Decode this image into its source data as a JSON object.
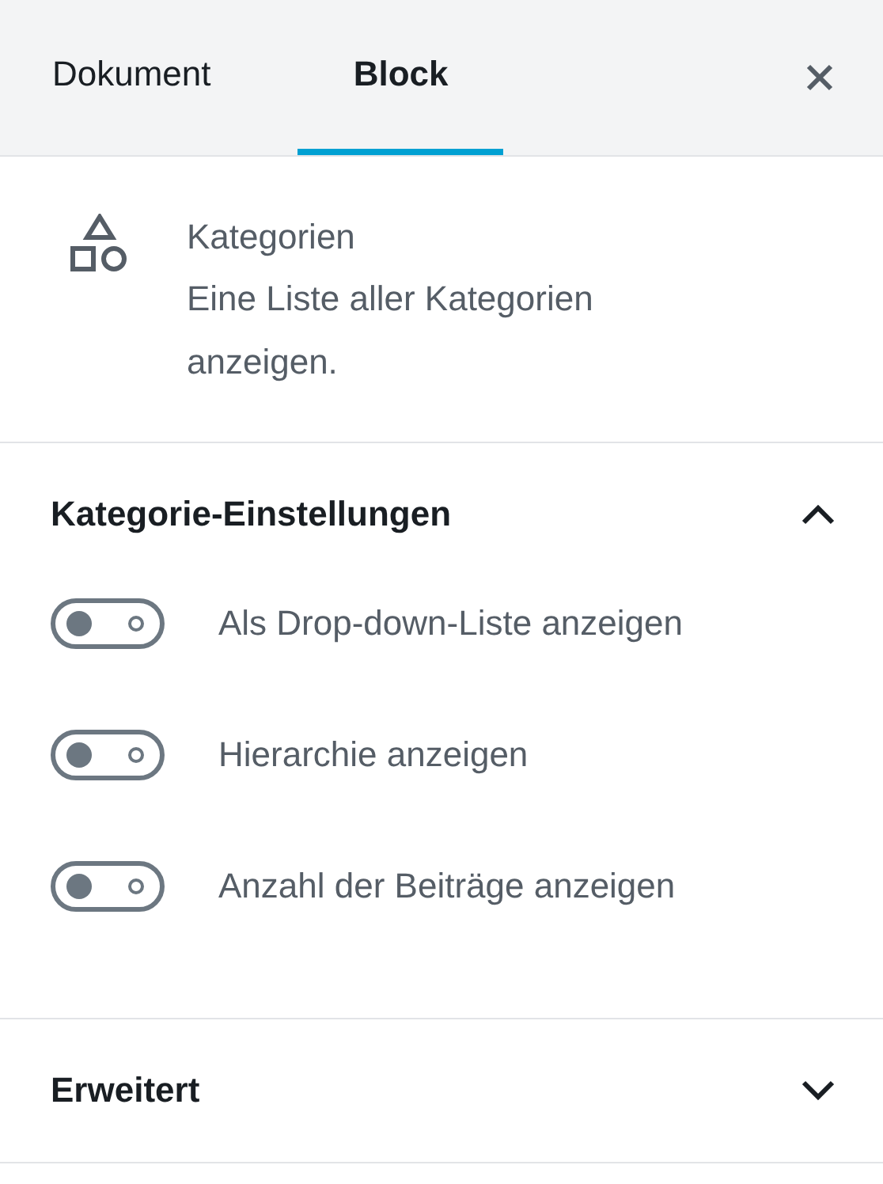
{
  "tabs": [
    {
      "label": "Dokument",
      "selected": false
    },
    {
      "label": "Block",
      "selected": true
    }
  ],
  "block": {
    "title": "Kategorien",
    "description": "Eine Liste aller Kategorien anzeigen."
  },
  "panels": [
    {
      "title": "Kategorie-Einstellungen",
      "expanded": true,
      "toggles": [
        {
          "label": "Als Drop-down-Liste anzeigen",
          "on": false
        },
        {
          "label": "Hierarchie anzeigen",
          "on": false
        },
        {
          "label": "Anzahl der Beiträge anzeigen",
          "on": false
        }
      ]
    },
    {
      "title": "Erweitert",
      "expanded": false
    }
  ]
}
